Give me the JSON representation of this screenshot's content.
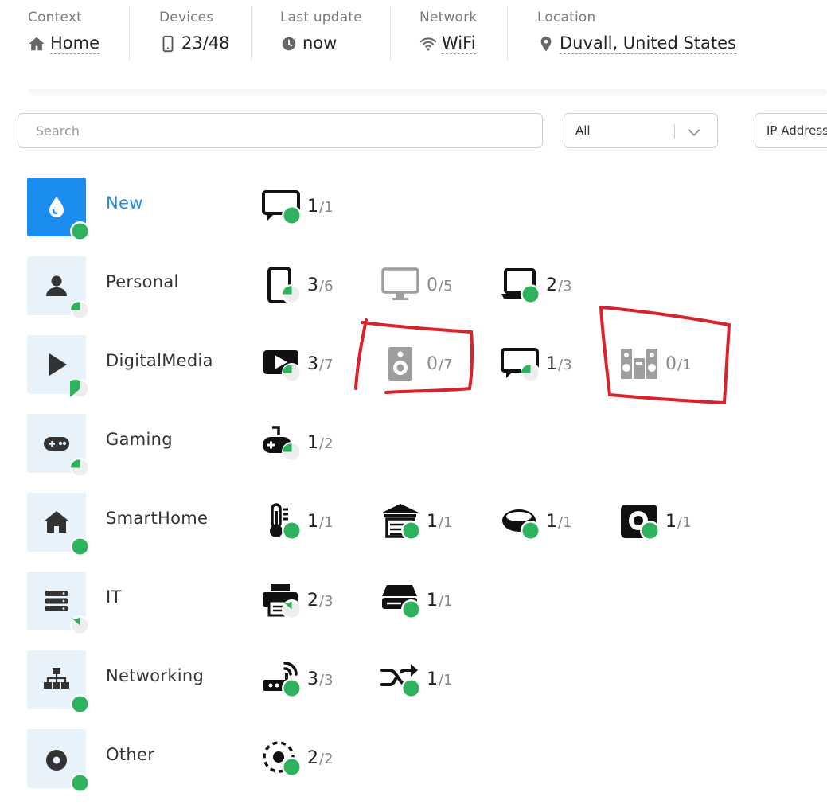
{
  "header": {
    "context": {
      "label": "Context",
      "value": "Home",
      "icon": "home-icon"
    },
    "devices": {
      "label": "Devices",
      "value": "23/48",
      "icon": "mobile-icon"
    },
    "last_update": {
      "label": "Last update",
      "value": "now",
      "icon": "clock-icon"
    },
    "network": {
      "label": "Network",
      "value": "WiFi",
      "icon": "wifi-icon"
    },
    "location": {
      "label": "Location",
      "value": "Duvall, United States",
      "icon": "map-pin-icon"
    }
  },
  "filters": {
    "search_placeholder": "Search",
    "type_select": {
      "selected": "All"
    },
    "sort_select": {
      "selected": "IP Address"
    }
  },
  "categories": [
    {
      "name": "New",
      "active": true,
      "icon": "drop-icon",
      "status": "full",
      "devices": [
        {
          "icon": "tv-chat-icon",
          "count": "1",
          "total": "/1",
          "status": "full"
        }
      ]
    },
    {
      "name": "Personal",
      "icon": "user-icon",
      "status": "half",
      "devices": [
        {
          "icon": "smartphone-icon",
          "count": "3",
          "total": "/6",
          "status": "half"
        },
        {
          "icon": "desktop-monitor-icon",
          "count": "0",
          "total": "/5",
          "status": "none"
        },
        {
          "icon": "laptop-icon",
          "count": "2",
          "total": "/3",
          "status": "full"
        }
      ]
    },
    {
      "name": "DigitalMedia",
      "icon": "play-icon",
      "status": "quarter",
      "devices": [
        {
          "icon": "video-player-icon",
          "count": "3",
          "total": "/7",
          "status": "half"
        },
        {
          "icon": "speaker-icon",
          "count": "0",
          "total": "/7",
          "status": "none"
        },
        {
          "icon": "tv-chat-icon",
          "count": "1",
          "total": "/3",
          "status": "half"
        },
        {
          "icon": "stereo-system-icon",
          "count": "0",
          "total": "/1",
          "status": "none"
        }
      ]
    },
    {
      "name": "Gaming",
      "icon": "gamepad-icon",
      "status": "half",
      "devices": [
        {
          "icon": "gamepad-cable-icon",
          "count": "1",
          "total": "/2",
          "status": "half"
        }
      ]
    },
    {
      "name": "SmartHome",
      "icon": "house-icon",
      "status": "full",
      "devices": [
        {
          "icon": "thermometer-icon",
          "count": "1",
          "total": "/1",
          "status": "full"
        },
        {
          "icon": "garage-icon",
          "count": "1",
          "total": "/1",
          "status": "full"
        },
        {
          "icon": "robot-vacuum-icon",
          "count": "1",
          "total": "/1",
          "status": "full"
        },
        {
          "icon": "smart-speaker-icon",
          "count": "1",
          "total": "/1",
          "status": "full"
        }
      ]
    },
    {
      "name": "IT",
      "icon": "server-icon",
      "status": "threequarter",
      "devices": [
        {
          "icon": "printer-icon",
          "count": "2",
          "total": "/3",
          "status": "threequarter"
        },
        {
          "icon": "nas-drive-icon",
          "count": "1",
          "total": "/1",
          "status": "full"
        }
      ]
    },
    {
      "name": "Networking",
      "icon": "network-tree-icon",
      "status": "full",
      "devices": [
        {
          "icon": "router-icon",
          "count": "3",
          "total": "/3",
          "status": "full"
        },
        {
          "icon": "switch-shuffle-icon",
          "count": "1",
          "total": "/1",
          "status": "full"
        }
      ]
    },
    {
      "name": "Other",
      "icon": "dot-circle-icon",
      "status": "full",
      "devices": [
        {
          "icon": "unknown-device-icon",
          "count": "2",
          "total": "/2",
          "status": "full"
        }
      ]
    }
  ],
  "colors": {
    "accent": "#1b8cf0",
    "online": "#2db35d",
    "tile_bg": "#e8f2fb",
    "annotation": "#d9232b"
  }
}
